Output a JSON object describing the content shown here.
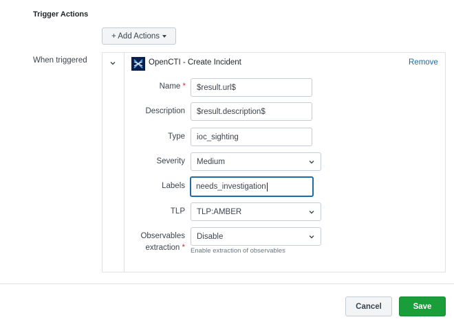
{
  "section": {
    "title": "Trigger Actions"
  },
  "add_actions": {
    "label": "+ Add Actions"
  },
  "when_triggered": {
    "label": "When triggered"
  },
  "action": {
    "title": "OpenCTI - Create Incident",
    "remove_label": "Remove",
    "icon": "opencti-logo-icon",
    "icon_color": "#0b1f4f"
  },
  "fields": {
    "name": {
      "label": "Name",
      "required_mark": "*",
      "value": "$result.url$"
    },
    "description": {
      "label": "Description",
      "value": "$result.description$"
    },
    "type": {
      "label": "Type",
      "value": "ioc_sighting"
    },
    "severity": {
      "label": "Severity",
      "value": "Medium"
    },
    "labels": {
      "label": "Labels",
      "value": "needs_investigation"
    },
    "tlp": {
      "label": "TLP",
      "value": "TLP:AMBER"
    },
    "observables": {
      "label_line1": "Observables",
      "label_line2": "extraction",
      "required_mark": "*",
      "value": "Disable",
      "help": "Enable extraction of observables"
    }
  },
  "footer": {
    "cancel_label": "Cancel",
    "save_label": "Save"
  },
  "colors": {
    "accent": "#1d6ba6",
    "save": "#1a9e3a",
    "required": "#d0342c"
  }
}
